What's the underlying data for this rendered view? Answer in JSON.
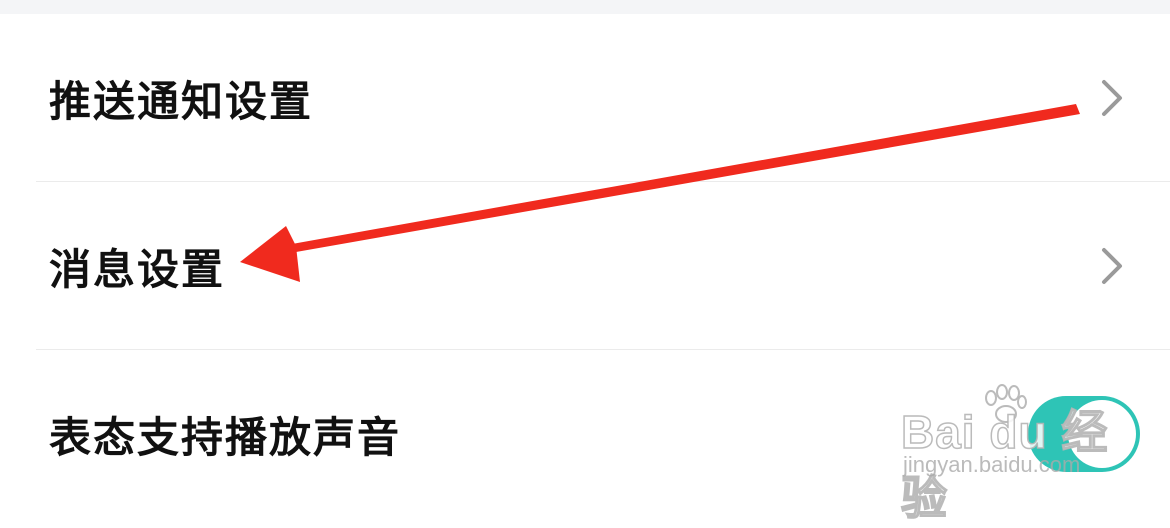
{
  "settings": {
    "push_notification_label": "推送通知设置",
    "message_settings_label": "消息设置",
    "reaction_sound_label": "表态支持播放声音",
    "reaction_sound_enabled": true
  },
  "watermark": {
    "brand": "Bai du 经验",
    "url": "jingyan.baidu.com"
  },
  "colors": {
    "toggle_on": "#2ec4b6",
    "annotation_arrow": "#f02a1e"
  }
}
